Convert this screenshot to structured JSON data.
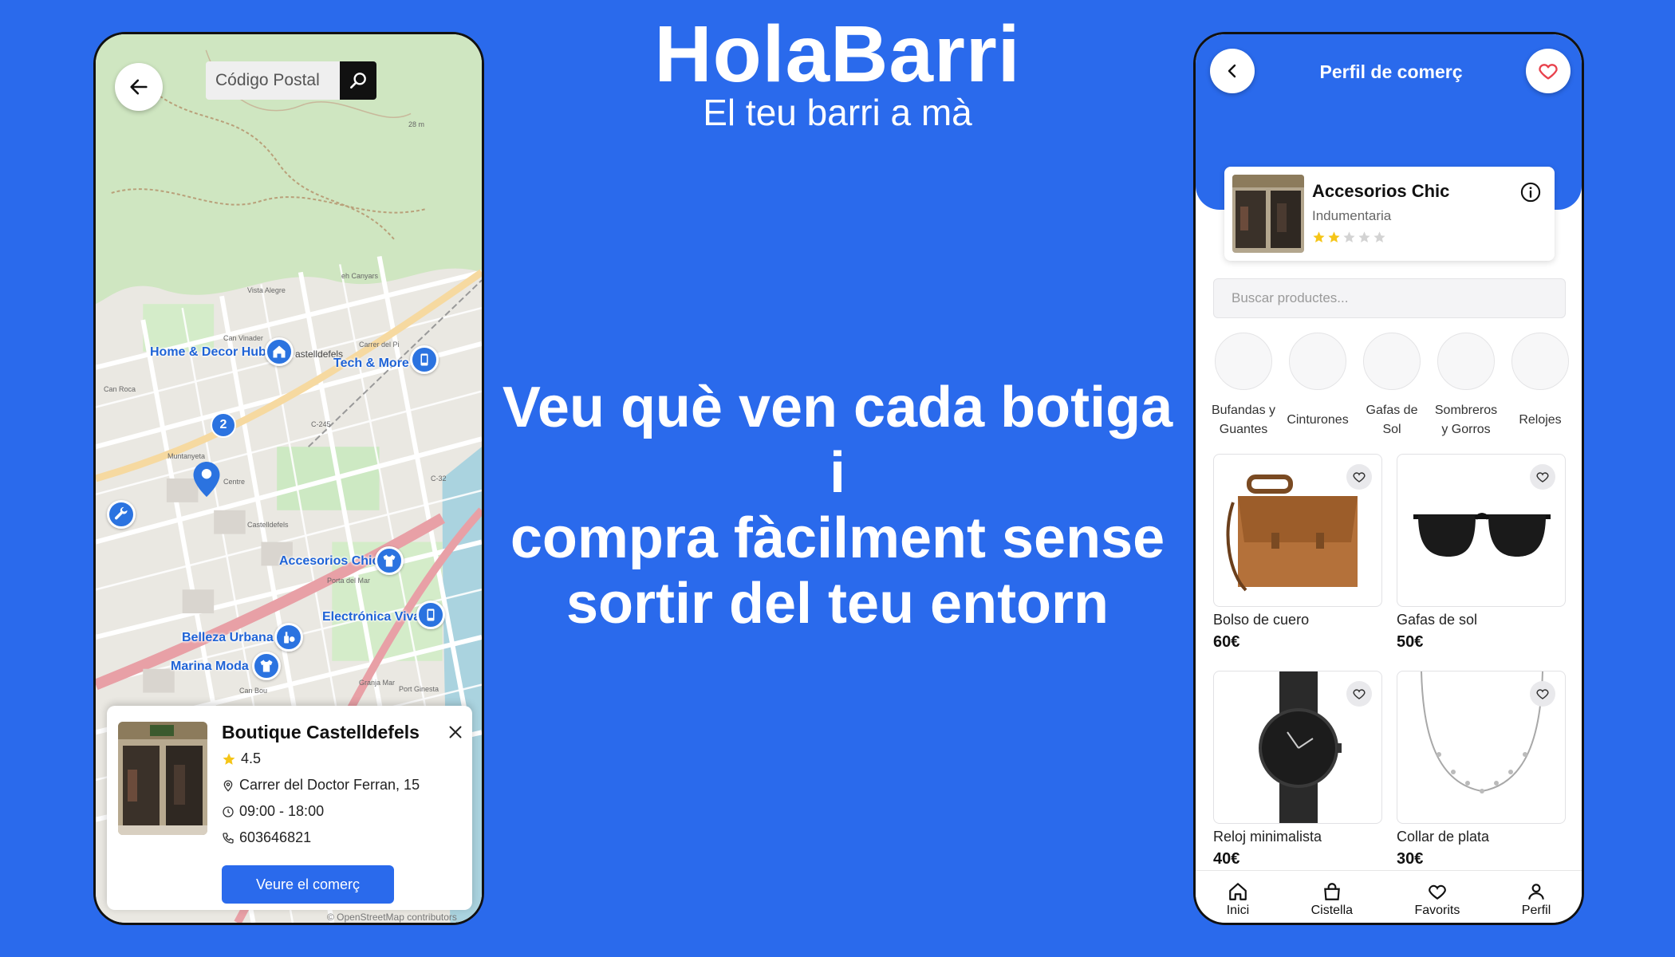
{
  "brand": {
    "name": "HolaBarri",
    "tagline": "El teu barri a mà"
  },
  "headline": {
    "line1": "Veu què ven cada botiga i",
    "line2": "compra fàcilment sense",
    "line3": "sortir del teu entorn"
  },
  "map_screen": {
    "search_placeholder": "Código Postal",
    "cluster_count": "2",
    "pins": [
      {
        "label": "Home & Decor Hub",
        "icon": "house-icon"
      },
      {
        "label": "Tech & More",
        "icon": "phone-icon"
      },
      {
        "label": "Accesorios Chic",
        "icon": "shirt-icon"
      },
      {
        "label": "Electrónica Viva",
        "icon": "phone-icon"
      },
      {
        "label": "Belleza Urbana",
        "icon": "beauty-icon"
      },
      {
        "label": "Marina Moda",
        "icon": "shirt-icon"
      }
    ],
    "places": [
      "Vista Alegre",
      "eh Canyars",
      "Can Vinader",
      "astelldefels",
      "Carrer del Pi",
      "Can Roca",
      "Muntanyeta",
      "Centre",
      "Castelldefels",
      "C-245",
      "C-32",
      "Porta del Mar",
      "Port Ginesta",
      "Granja Mar",
      "Can Bou",
      "28 m"
    ],
    "sheet": {
      "title": "Boutique Castelldefels",
      "rating": "4.5",
      "address": "Carrer del Doctor Ferran, 15",
      "hours": "09:00 - 18:00",
      "phone": "603646821",
      "cta": "Veure el comerç"
    },
    "attribution": "© OpenStreetMap contributors"
  },
  "shop_screen": {
    "title": "Perfil de comerç",
    "store": {
      "name": "Accesorios Chic",
      "category": "Indumentaria",
      "rating_stars": 2,
      "max_stars": 5
    },
    "search_placeholder": "Buscar productes...",
    "categories": [
      "Bufandas y Guantes",
      "Cinturones",
      "Gafas de Sol",
      "Sombreros y Gorros",
      "Relojes"
    ],
    "products": [
      {
        "name": "Bolso de cuero",
        "price": "60€"
      },
      {
        "name": "Gafas de sol",
        "price": "50€"
      },
      {
        "name": "Reloj minimalista",
        "price": "40€"
      },
      {
        "name": "Collar de plata",
        "price": "30€"
      }
    ],
    "nav": [
      "Inici",
      "Cistella",
      "Favorits",
      "Perfil"
    ]
  },
  "colors": {
    "brand_blue": "#2a6aec",
    "pin_blue": "#2b73e0",
    "star": "#f5c518",
    "heart_red": "#e8414c"
  }
}
